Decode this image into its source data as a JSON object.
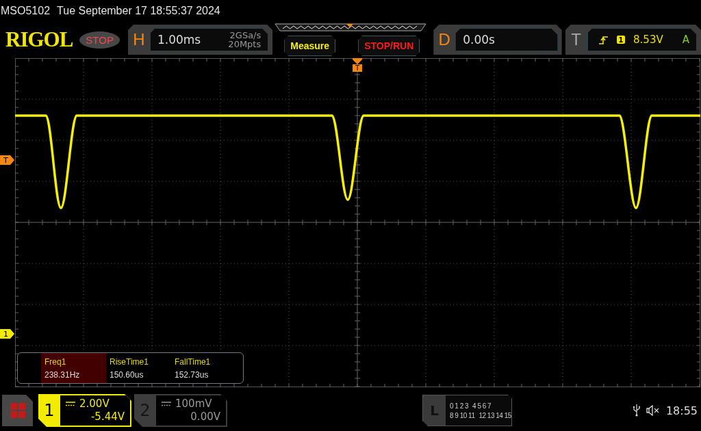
{
  "header": {
    "model": "MSO5102",
    "datetime": "Tue September 17 18:55:37 2024"
  },
  "toolbar": {
    "logo": "RIGOL",
    "run_state": "STOP",
    "horizontal": {
      "letter": "H",
      "timebase": "1.00ms",
      "sample_rate": "2GSa/s",
      "memory_depth": "20Mpts"
    },
    "buttons": [
      {
        "label": "Measure",
        "kind": "measure"
      },
      {
        "label": "STOP/RUN",
        "kind": "stoprun"
      }
    ],
    "delay": {
      "letter": "D",
      "value": "0.00s"
    },
    "trigger": {
      "letter": "T",
      "source": "1",
      "level": "8.53V",
      "mode": "A"
    }
  },
  "markers": {
    "trigger_position": "T",
    "trigger_level": "T",
    "channel": "1"
  },
  "measurements": [
    {
      "label": "Freq1",
      "value": "238.31Hz",
      "selected": true
    },
    {
      "label": "RiseTime1",
      "value": "150.60us",
      "selected": false
    },
    {
      "label": "FallTime1",
      "value": "152.73us",
      "selected": false
    }
  ],
  "channels": [
    {
      "number": "1",
      "scale": "2.00V",
      "offset": "-5.44V",
      "active": true
    },
    {
      "number": "2",
      "scale": "100mV",
      "offset": "0.00V",
      "active": false
    }
  ],
  "logic": {
    "letter": "L",
    "rows": [
      [
        "0 1 2 3",
        "4 5 6 7"
      ],
      [
        "8 9 10 11",
        "12 13 14 15"
      ]
    ]
  },
  "status": {
    "time": "18:55"
  }
}
